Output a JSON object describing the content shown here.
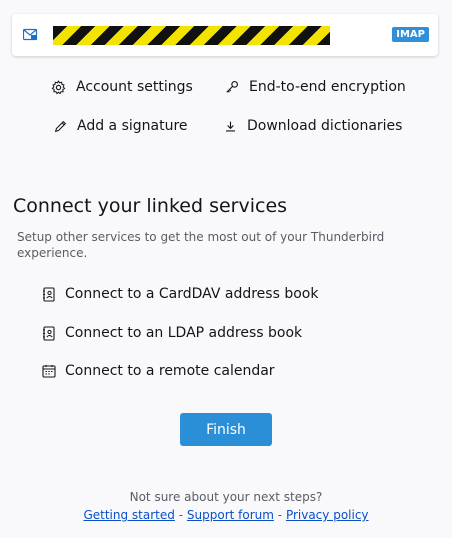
{
  "account": {
    "type_badge": "IMAP",
    "icon": "mail-account-icon"
  },
  "quick_links": {
    "account_settings": "Account settings",
    "end_to_end_encryption": "End-to-end encryption",
    "add_signature": "Add a signature",
    "download_dictionaries": "Download dictionaries"
  },
  "linked_services": {
    "title": "Connect your linked services",
    "description": "Setup other services to get the most out of your Thunderbird experience.",
    "items": [
      {
        "label": "Connect to a CardDAV address book",
        "icon": "address-book-icon"
      },
      {
        "label": "Connect to an LDAP address book",
        "icon": "address-book-icon"
      },
      {
        "label": "Connect to a remote calendar",
        "icon": "calendar-icon"
      }
    ]
  },
  "finish_label": "Finish",
  "footer": {
    "prompt": "Not sure about your next steps?",
    "getting_started": "Getting started",
    "support_forum": "Support forum",
    "privacy_policy": "Privacy policy",
    "separator": "-"
  },
  "colors": {
    "accent": "#2b8fd8",
    "link": "#0b4fc9",
    "background": "#f9f9fb"
  }
}
